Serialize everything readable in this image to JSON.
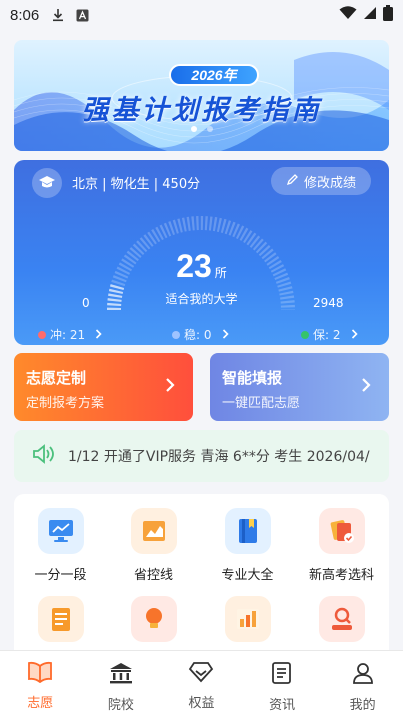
{
  "status_bar": {
    "time": "8:06"
  },
  "banner": {
    "year": "2026年",
    "title": "强基计划报考指南"
  },
  "score_card": {
    "info": "北京 | 物化生 | 450分",
    "edit_label": "修改成绩",
    "count": "23",
    "count_unit": "所",
    "subtitle": "适合我的大学",
    "range_min": "0",
    "range_max": "2948",
    "categories": [
      {
        "label": "冲: 21",
        "color": "#ff6b6b"
      },
      {
        "label": "稳: 0",
        "color": "#9fc3ff"
      },
      {
        "label": "保: 2",
        "color": "#35c46a"
      }
    ]
  },
  "features": [
    {
      "title": "志愿定制",
      "subtitle": "定制报考方案"
    },
    {
      "title": "智能填报",
      "subtitle": "一键匹配志愿"
    }
  ],
  "ticker": {
    "message": "1/12 开通了VIP服务 青海 6**分 考生 2026/04/"
  },
  "grid": {
    "items": [
      {
        "label": "一分一段",
        "icon": "chart-screen-icon"
      },
      {
        "label": "省控线",
        "icon": "area-chart-icon"
      },
      {
        "label": "专业大全",
        "icon": "book-icon"
      },
      {
        "label": "新高考选科",
        "icon": "cards-check-icon"
      },
      {
        "label": "",
        "icon": "notepad-icon"
      },
      {
        "label": "",
        "icon": "lightbulb-icon"
      },
      {
        "label": "",
        "icon": "bar-chart-icon"
      },
      {
        "label": "",
        "icon": "search-person-icon"
      }
    ]
  },
  "tabbar": {
    "tabs": [
      {
        "label": "志愿",
        "active": true
      },
      {
        "label": "院校"
      },
      {
        "label": "权益"
      },
      {
        "label": "资讯"
      },
      {
        "label": "我的"
      }
    ]
  },
  "colors": {
    "accent": "#ff6a2b",
    "primary_blue": "#3a83f2"
  }
}
